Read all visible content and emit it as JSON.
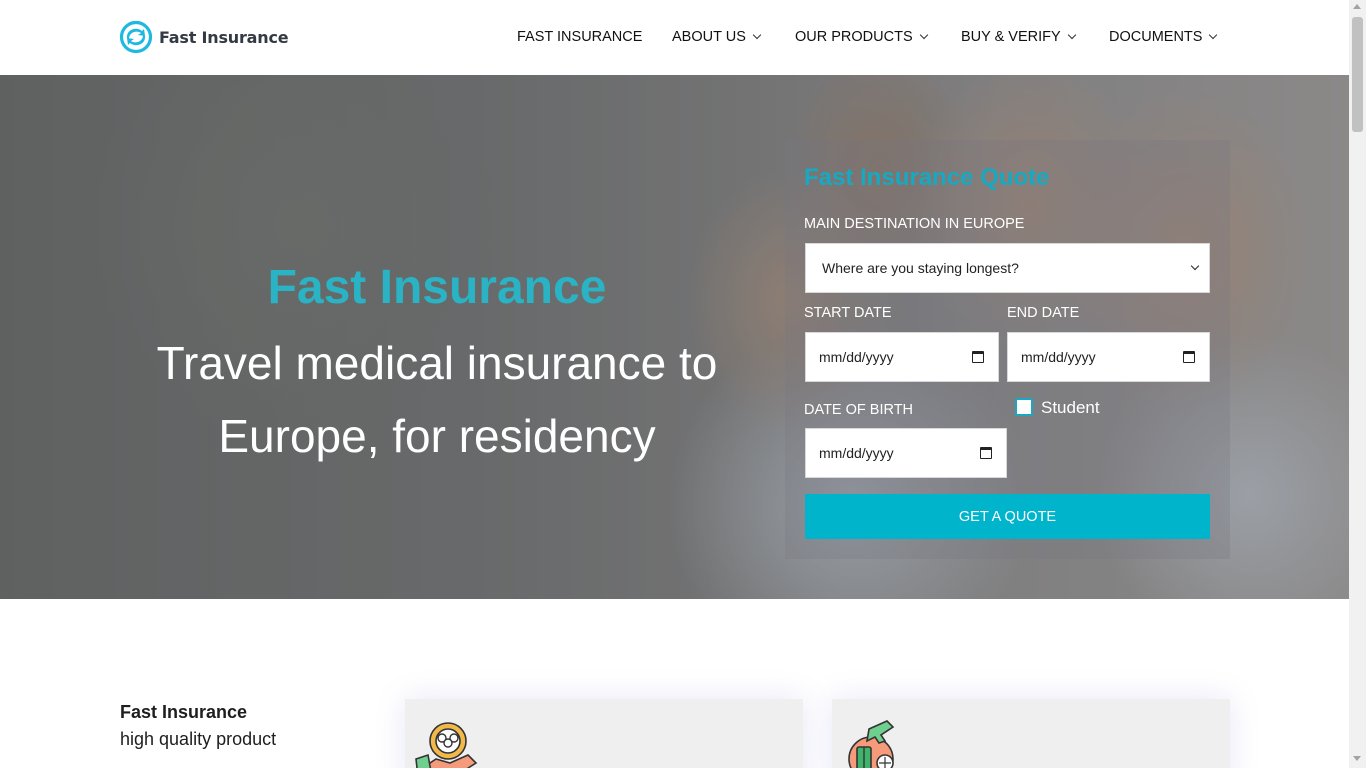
{
  "header": {
    "logo_text": "Fast Insurance",
    "nav": [
      {
        "label": "FAST INSURANCE",
        "has_dropdown": false
      },
      {
        "label": "ABOUT US",
        "has_dropdown": true
      },
      {
        "label": "OUR PRODUCTS",
        "has_dropdown": true
      },
      {
        "label": "BUY & VERIFY",
        "has_dropdown": true
      },
      {
        "label": "DOCUMENTS",
        "has_dropdown": true
      }
    ]
  },
  "hero": {
    "title": "Fast Insurance",
    "subtitle": "Travel medical insurance to Europe, for residency"
  },
  "quote_form": {
    "title": "Fast Insurance Quote",
    "destination_label": "MAIN DESTINATION IN EUROPE",
    "destination_value": "Where are you staying longest?",
    "start_date_label": "START DATE",
    "start_date_placeholder": "mm/dd/yyyy",
    "end_date_label": "END DATE",
    "end_date_placeholder": "mm/dd/yyyy",
    "dob_label": "DATE OF BIRTH",
    "dob_placeholder": "mm/dd/yyyy",
    "student_label": "Student",
    "student_checked": false,
    "submit_label": "GET A QUOTE"
  },
  "below": {
    "title": "Fast Insurance",
    "subtitle": "high quality product"
  },
  "colors": {
    "accent": "#00b4cc",
    "accent_text": "#29b3c4",
    "quote_title": "#17a9c1",
    "nav_text": "#111111"
  },
  "icons": {
    "logo": "circular-arrows-logo-icon",
    "card_1": "people-gear-handshake-icon",
    "card_2": "travel-luggage-globe-icon"
  }
}
